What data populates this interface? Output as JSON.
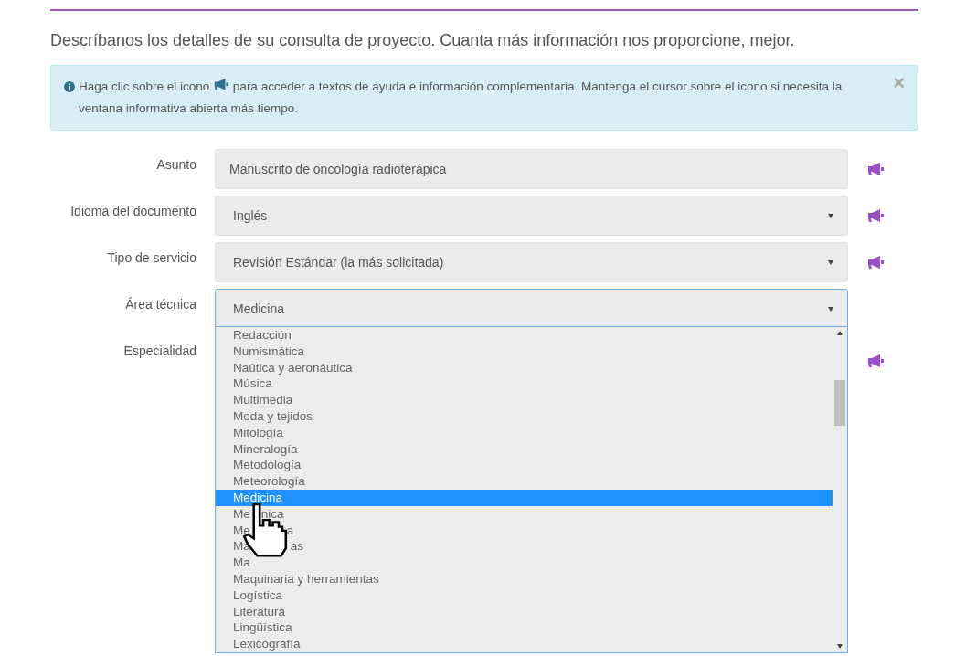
{
  "intro": "Descríbanos los detalles de su consulta de proyecto. Cuanta más información nos proporcione, mejor.",
  "alert": {
    "before": "Haga clic sobre el icono",
    "after": "para acceder a textos de ayuda e información complementaria. Mantenga el cursor sobre el icono si necesita la ventana informativa abierta más tiempo.",
    "close": "×"
  },
  "fields": [
    {
      "label": "Asunto",
      "kind": "text",
      "value": "Manuscrito de oncología radioterápica",
      "help": true
    },
    {
      "label": "Idioma del documento",
      "kind": "select",
      "value": "Inglés",
      "help": true
    },
    {
      "label": "Tipo de servicio",
      "kind": "select",
      "value": "Revisión Estándar (la más solicitada)",
      "help": true
    },
    {
      "label": "Área técnica",
      "kind": "select",
      "value": "Medicina",
      "help": false,
      "open": true
    },
    {
      "label": "Especialidad",
      "kind": "label",
      "help": true
    }
  ],
  "dropdown": {
    "options": [
      {
        "label": "Redacción",
        "selected": false
      },
      {
        "label": "Numismática",
        "selected": false
      },
      {
        "label": "Naútica y aeronáutica",
        "selected": false
      },
      {
        "label": "Música",
        "selected": false
      },
      {
        "label": "Multimedia",
        "selected": false
      },
      {
        "label": "Moda y tejidos",
        "selected": false
      },
      {
        "label": "Mitología",
        "selected": false
      },
      {
        "label": "Mineralogía",
        "selected": false
      },
      {
        "label": "Metodología",
        "selected": false
      },
      {
        "label": "Meteorología",
        "selected": false
      },
      {
        "label": "Medicina",
        "selected": true
      },
      {
        "label": "Me",
        "tail": "nica",
        "selected": false
      },
      {
        "label": "Me",
        "tail": "a",
        "selected": false
      },
      {
        "label": "Ma",
        "tail": "as",
        "selected": false
      },
      {
        "label": "Ma",
        "selected": false
      },
      {
        "label": "Maquinaria y herramientas",
        "selected": false
      },
      {
        "label": "Logística",
        "selected": false
      },
      {
        "label": "Literatura",
        "selected": false
      },
      {
        "label": "Lingüística",
        "selected": false
      },
      {
        "label": "Lexicografía",
        "selected": false
      }
    ]
  }
}
